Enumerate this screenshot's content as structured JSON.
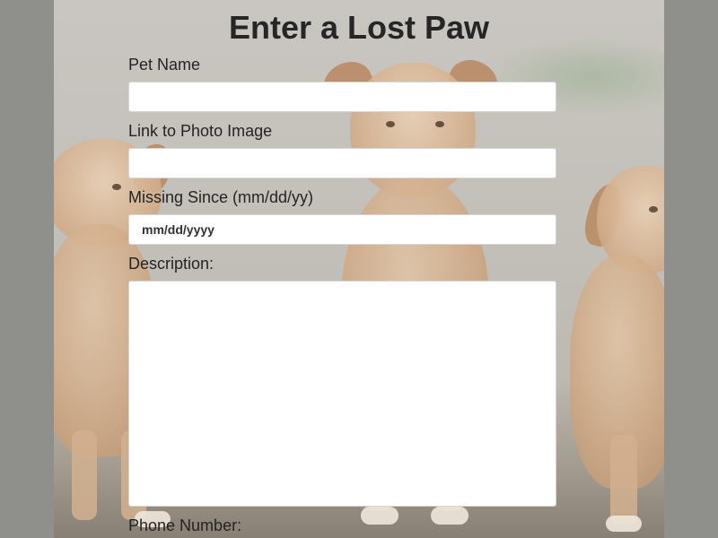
{
  "form": {
    "title": "Enter a Lost Paw",
    "pet_name": {
      "label": "Pet Name",
      "value": ""
    },
    "photo_link": {
      "label": "Link to Photo Image",
      "value": ""
    },
    "missing_since": {
      "label": "Missing Since (mm/dd/yy)",
      "placeholder": "mm/dd/yyyy"
    },
    "description": {
      "label": "Description:",
      "value": ""
    },
    "phone": {
      "label": "Phone Number:"
    }
  }
}
